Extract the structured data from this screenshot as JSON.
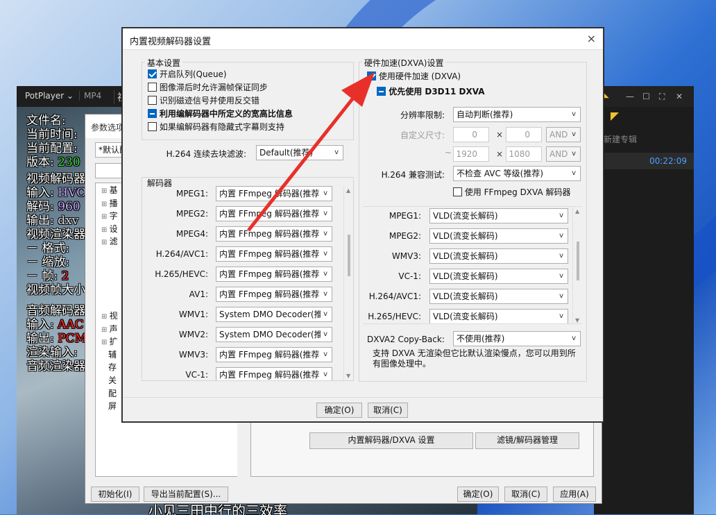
{
  "potplayer": {
    "app_name": "PotPlayer",
    "tab_format": "MP4",
    "tab_partial": "视",
    "osd": {
      "file_name_label": "文件名:",
      "current_time_label": "当前时间:",
      "current_config_label": "当前配置:",
      "version_label": "版本:",
      "version_value": "230",
      "video_decoder_label": "视频解码器",
      "input_label": "输入:",
      "input_value": "HVC",
      "decode_label": "解码:",
      "decode_value": "960",
      "output_label": "输出:",
      "output_value": "dxv",
      "video_renderer_label": "视频渲染器",
      "format_label": "－ 格式:",
      "scale_label": "－ 缩放:",
      "frame_label": "－ 帧:",
      "frame_value": "2",
      "frame_size_label": "视频帧大小",
      "audio_decoder_label": "音频解码器",
      "audio_input_label": "输入:",
      "audio_input_value": "AAC",
      "audio_output_label": "输出:",
      "audio_output_value": "PCM",
      "render_input_label": "渲染输入:",
      "audio_renderer_label": "音频渲染器"
    },
    "bottom_subtitle": "小见三田中行的三效率"
  },
  "playlist": {
    "tab": "新建专辑",
    "duration": "00:22:09",
    "btn_min": "—",
    "btn_max": "☐",
    "btn_full": "⛶",
    "btn_close": "✕"
  },
  "options": {
    "title": "参数选项",
    "preset": "*默认配",
    "tree": [
      "基",
      "播",
      "字",
      "设",
      "滤",
      "视",
      "声",
      "扩",
      "辅",
      "存",
      "关",
      "配",
      "屏"
    ],
    "btn_builtin": "内置解码器/DXVA 设置",
    "btn_filter": "滤镜/解码器管理",
    "btn_init": "初始化(I)",
    "btn_export": "导出当前配置(S)...",
    "btn_ok": "确定(O)",
    "btn_cancel": "取消(C)",
    "btn_apply": "应用(A)"
  },
  "dialog": {
    "title": "内置视频解码器设置",
    "close": "×",
    "basic": {
      "title": "基本设置",
      "items": [
        {
          "label": "开启队列(Queue)",
          "state": "checked"
        },
        {
          "label": "图像滞后时允许漏帧保证同步",
          "state": "unchecked"
        },
        {
          "label": "识别磁迹信号并使用反交错",
          "state": "unchecked"
        },
        {
          "label": "利用编解码器中所定义的宽高比信息",
          "state": "indeterminate"
        },
        {
          "label": "如果编解码器有隐藏式字幕则支持",
          "state": "unchecked"
        }
      ],
      "deblock_label": "H.264 连续去块滤波:",
      "deblock_value": "Default(推荐)"
    },
    "decoders": {
      "title": "解码器",
      "rows": [
        {
          "label": "MPEG1:",
          "value": "内置 FFmpeg 解码器(推荐"
        },
        {
          "label": "MPEG2:",
          "value": "内置 FFmpeg 解码器(推荐"
        },
        {
          "label": "MPEG4:",
          "value": "内置 FFmpeg 解码器(推荐"
        },
        {
          "label": "H.264/AVC1:",
          "value": "内置 FFmpeg 解码器(推荐"
        },
        {
          "label": "H.265/HEVC:",
          "value": "内置 FFmpeg 解码器(推荐"
        },
        {
          "label": "AV1:",
          "value": "内置 FFmpeg 解码器(推荐"
        },
        {
          "label": "WMV1:",
          "value": "System DMO Decoder(推荐"
        },
        {
          "label": "WMV2:",
          "value": "System DMO Decoder(推荐"
        },
        {
          "label": "WMV3:",
          "value": "内置 FFmpeg 解码器(推荐"
        },
        {
          "label": "VC-1:",
          "value": "内置 FFmpeg 解码器(推荐"
        }
      ]
    },
    "hw": {
      "title": "硬件加速(DXVA)设置",
      "use_hw": "使用硬件加速 (DXVA)",
      "prefer_d3d11": "优先使用 D3D11 DXVA",
      "resolution_label": "分辨率限制:",
      "resolution_value": "自动判断(推荐)",
      "custom_size_label": "自定义尺寸:",
      "min_w": "0",
      "min_h": "0",
      "max_w": "1920",
      "max_h": "1080",
      "and1": "AND",
      "and2": "AND",
      "times": "×",
      "tilde": "~",
      "h264_compat_label": "H.264 兼容测试:",
      "h264_compat_value": "不检查 AVC 等级(推荐)",
      "ffmpeg_dxva": "使用 FFmpeg DXVA 解码器",
      "rows": [
        {
          "label": "MPEG1:",
          "value": "VLD(流变长解码)"
        },
        {
          "label": "MPEG2:",
          "value": "VLD(流变长解码)"
        },
        {
          "label": "WMV3:",
          "value": "VLD(流变长解码)"
        },
        {
          "label": "VC-1:",
          "value": "VLD(流变长解码)"
        },
        {
          "label": "H.264/AVC1:",
          "value": "VLD(流变长解码)"
        },
        {
          "label": "H.265/HEVC:",
          "value": "VLD(流变长解码)"
        }
      ],
      "copyback_label": "DXVA2 Copy-Back:",
      "copyback_value": "不使用(推荐)",
      "note": "支持 DXVA 无渲染但它比默认渲染慢点，您可以用到所有图像处理中。"
    },
    "ok": "确定(O)",
    "cancel": "取消(C)"
  },
  "colors": {
    "accent": "#0067c0",
    "arrow": "#e8302a",
    "osd_value": "#3fdc3f"
  }
}
